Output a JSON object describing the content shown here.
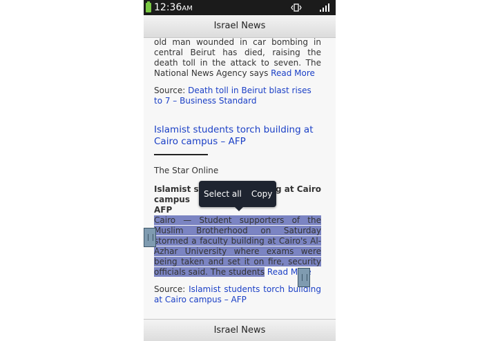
{
  "status_bar": {
    "time": "12:36",
    "ampm": "AM"
  },
  "header": {
    "title": "Israel News"
  },
  "footer": {
    "title": "Israel News"
  },
  "article1": {
    "text": "old man wounded in car bombing in central Beirut has died, raising the death toll in the attack to seven. The National News Agency says ",
    "read_more": "Read More",
    "source_label": "Source: ",
    "source_link": "Death toll in Beirut blast rises to 7 – Business Standard"
  },
  "article2": {
    "headline": "Islamist students torch building at Cairo campus – AFP",
    "publisher": "The Star Online",
    "bold_title_a": "Islamist st",
    "bold_title_b": "g at Cairo",
    "bold_title_c": "campus",
    "bold_title_d": "AFP",
    "selected_text": "Cairo — Student supporters of the Muslim Brotherhood on Saturday stormed a faculty building at Cairo's Al-Azhar University where exams were being taken and set it on fire, security officials said. The students",
    "read_more": "Read More",
    "source_label": "Source: ",
    "source_link": "Islamist students torch building at Cairo campus – AFP"
  },
  "popup": {
    "select_all": "Select all",
    "copy": "Copy"
  }
}
